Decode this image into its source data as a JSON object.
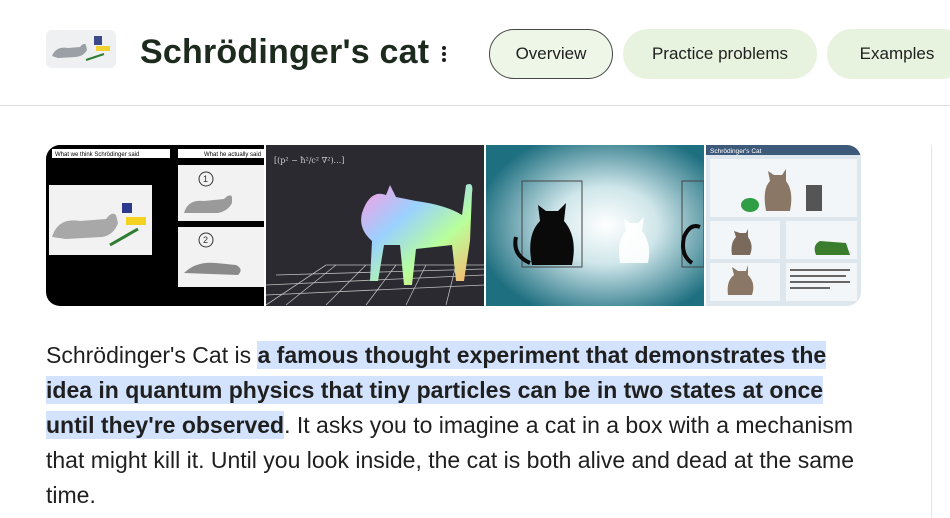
{
  "header": {
    "title": "Schrödinger's cat",
    "tabs": [
      {
        "label": "Overview",
        "active": true
      },
      {
        "label": "Practice problems",
        "active": false
      },
      {
        "label": "Examples",
        "active": false
      }
    ]
  },
  "images": [
    {
      "captions": [
        "What we think Schrödinger said",
        "What he actually said"
      ],
      "markers": [
        "1",
        "2"
      ]
    },
    {
      "equation": "[(p² − ħ²/c² ∇²)...]"
    },
    {},
    {
      "title": "Schrödinger's Cat"
    }
  ],
  "paragraph": {
    "lead": "Schrödinger's Cat is ",
    "highlight": "a famous thought experiment that demonstrates the idea in quantum physics that tiny particles can be in two states at once until they're observed",
    "rest": ". It asks you to imagine a cat in a box with a mechanism that might kill it. Until you look inside, the cat is both alive and dead at the same time."
  },
  "colors": {
    "chip_bg": "#e8f3df",
    "active_chip_bg": "#eef6e8",
    "highlight": "#d3e3fd",
    "title": "#1c2b1e"
  },
  "icons": [
    "more-vert-icon"
  ]
}
